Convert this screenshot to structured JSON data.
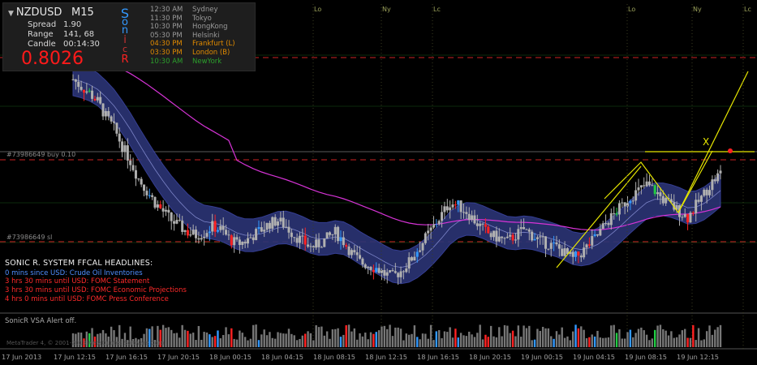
{
  "header": {
    "symbol": "NZDUSD",
    "timeframe": "M15",
    "spread_label": "Spread",
    "spread_value": "1.90",
    "range_label": "Range",
    "range_value": "141, 68",
    "candle_label": "Candle",
    "candle_value": "00:14:30",
    "price": "0.8026"
  },
  "sonic_letters": [
    {
      "ch": "S",
      "color": "#3399ff"
    },
    {
      "ch": "o",
      "color": "#3399ff"
    },
    {
      "ch": "n",
      "color": "#3399ff"
    },
    {
      "ch": "i",
      "color": "#cc3333"
    },
    {
      "ch": "c",
      "color": "#cc3333"
    },
    {
      "ch": "R",
      "color": "#ff2222"
    }
  ],
  "sessions": [
    {
      "time": "12:30 AM",
      "name": "Sydney",
      "color": "#9a9a9a"
    },
    {
      "time": "11:30 PM",
      "name": "Tokyo",
      "color": "#9a9a9a"
    },
    {
      "time": "10:30 PM",
      "name": "HongKong",
      "color": "#9a9a9a"
    },
    {
      "time": "05:30 PM",
      "name": "Helsinki",
      "color": "#9a9a9a"
    },
    {
      "time": "04:30 PM",
      "name": "Frankfurt  (L)",
      "color": "#e08a00"
    },
    {
      "time": "03:30 PM",
      "name": "London  (B)",
      "color": "#e08a00"
    },
    {
      "time": "10:30 AM",
      "name": "NewYork",
      "color": "#2ca02c"
    }
  ],
  "headlines": {
    "title": "SONIC R. SYSTEM  FFCAL HEADLINES:",
    "items": [
      {
        "text": "0 mins since USD: Crude Oil Inventories",
        "color": "#4f8fff"
      },
      {
        "text": "3 hrs 30 mins until USD: FOMC Statement",
        "color": "#ff2a2a"
      },
      {
        "text": "3 hrs 30 mins until USD: FOMC Economic Projections",
        "color": "#ff2a2a"
      },
      {
        "text": "4 hrs 0 mins until USD: FOMC Press Conference",
        "color": "#ff2a2a"
      }
    ]
  },
  "orders": {
    "buy_label": "#73986649 buy 0.10",
    "sl_label": "#73986649 sl"
  },
  "indicator": {
    "label": "SonicR VSA    Alert off."
  },
  "copyright": "MetaTrader 4, © 2001-2013 MetaQuotes Software Corp.",
  "session_markers": [
    {
      "label": "Lo",
      "color": "#9aa05a"
    },
    {
      "label": "Ny",
      "color": "#9aa05a"
    },
    {
      "label": "Lc",
      "color": "#9aa05a"
    },
    {
      "label": "Lo",
      "color": "#9aa05a"
    },
    {
      "label": "Ny",
      "color": "#9aa05a"
    },
    {
      "label": "Lc",
      "color": "#9aa05a"
    }
  ],
  "annotations": {
    "x_mark": "X"
  },
  "colors": {
    "background": "#000000",
    "band": "#2b3374",
    "band_edge": "#3a44a0",
    "ema_slow": "#d633d6",
    "candle_neutral": "#b0b0b0",
    "candle_bull": "#3399ff",
    "candle_bear": "#ff2222",
    "candle_climax": "#22cc44",
    "level_red": "#cc2222",
    "trend_yellow": "#e6e600",
    "volume_grey": "#777777"
  },
  "chart_data": {
    "type": "candlestick",
    "instrument": "NZDUSD",
    "timeframe": "M15",
    "x_tick_labels": [
      "17 Jun 2013",
      "17 Jun 12:15",
      "17 Jun 16:15",
      "17 Jun 20:15",
      "18 Jun 00:15",
      "18 Jun 04:15",
      "18 Jun 08:15",
      "18 Jun 12:15",
      "18 Jun 16:15",
      "18 Jun 20:15",
      "19 Jun 00:15",
      "19 Jun 04:15",
      "19 Jun 08:15",
      "19 Jun 12:15"
    ],
    "close_path": [
      0.8095,
      0.809,
      0.8086,
      0.808,
      0.807,
      0.8062,
      0.805,
      0.804,
      0.8028,
      0.802,
      0.8012,
      0.8006,
      0.8,
      0.7996,
      0.7992,
      0.799,
      0.7992,
      0.7996,
      0.7994,
      0.7988,
      0.7984,
      0.7986,
      0.799,
      0.7994,
      0.7998,
      0.8,
      0.7996,
      0.799,
      0.7986,
      0.7982,
      0.7984,
      0.7988,
      0.7992,
      0.7986,
      0.7978,
      0.7972,
      0.797,
      0.7968,
      0.7964,
      0.7962,
      0.7966,
      0.7972,
      0.798,
      0.7988,
      0.7996,
      0.8004,
      0.8012,
      0.801,
      0.8006,
      0.8,
      0.7994,
      0.799,
      0.7988,
      0.7986,
      0.799,
      0.7994,
      0.799,
      0.7986,
      0.7984,
      0.7982,
      0.7978,
      0.7974,
      0.7978,
      0.7984,
      0.799,
      0.7998,
      0.8004,
      0.801,
      0.8016,
      0.802,
      0.8024,
      0.802,
      0.8014,
      0.801,
      0.8006,
      0.8002,
      0.801,
      0.8018,
      0.8026,
      0.8032
    ]
  }
}
